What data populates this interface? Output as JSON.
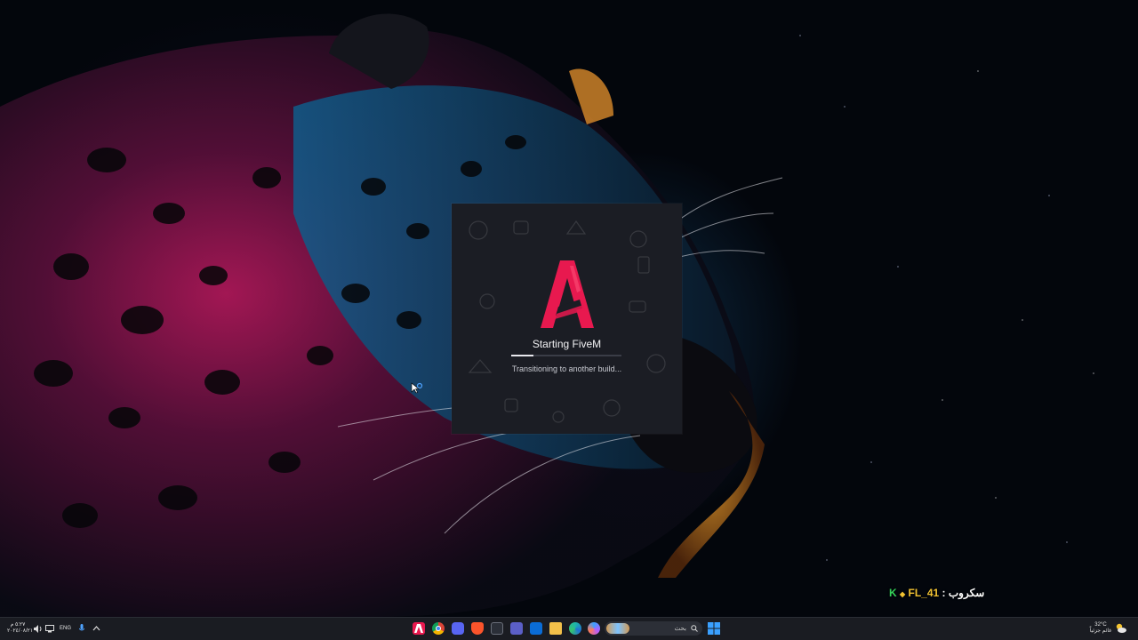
{
  "loader": {
    "title": "Starting FiveM",
    "status": "Transitioning to another build...",
    "progress_fraction": 0.2,
    "accent_color": "#e8194f"
  },
  "overlay": {
    "k": "K",
    "code": "FL_41",
    "sep": " : ",
    "label": "سكروب"
  },
  "taskbar": {
    "clock_time": "٥:٢٧ م",
    "clock_date": "٢٠٢٤/٠٨/٢١",
    "language": "ENG",
    "search_placeholder": "بحث",
    "weather_temp": "32°C",
    "weather_text": "غائم جزئياً",
    "icons": [
      "fivem-icon",
      "chrome-icon",
      "discord-icon",
      "brave-icon",
      "terminal-icon",
      "teams-icon",
      "store-icon",
      "file-explorer-icon",
      "edge-icon",
      "copilot-icon",
      "search-icon",
      "start-icon"
    ]
  }
}
